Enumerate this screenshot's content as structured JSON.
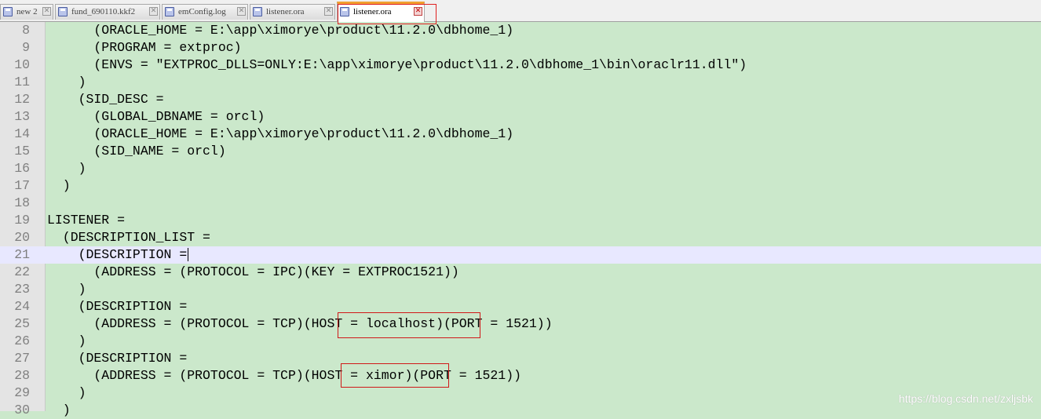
{
  "tabs": [
    {
      "label": "new 2",
      "active": false
    },
    {
      "label": "fund_690110.kkf2",
      "active": false
    },
    {
      "label": "emConfig.log",
      "active": false
    },
    {
      "label": "listener.ora",
      "active": false
    },
    {
      "label": "listener.ora",
      "active": true
    }
  ],
  "editor": {
    "current_line": 21,
    "lines": [
      {
        "num": "8",
        "text": "      (ORACLE_HOME = E:\\app\\ximorye\\product\\11.2.0\\dbhome_1)"
      },
      {
        "num": "9",
        "text": "      (PROGRAM = extproc)"
      },
      {
        "num": "10",
        "text": "      (ENVS = \"EXTPROC_DLLS=ONLY:E:\\app\\ximorye\\product\\11.2.0\\dbhome_1\\bin\\oraclr11.dll\")"
      },
      {
        "num": "11",
        "text": "    )"
      },
      {
        "num": "12",
        "text": "    (SID_DESC ="
      },
      {
        "num": "13",
        "text": "      (GLOBAL_DBNAME = orcl)"
      },
      {
        "num": "14",
        "text": "      (ORACLE_HOME = E:\\app\\ximorye\\product\\11.2.0\\dbhome_1)"
      },
      {
        "num": "15",
        "text": "      (SID_NAME = orcl)"
      },
      {
        "num": "16",
        "text": "    )"
      },
      {
        "num": "17",
        "text": "  )"
      },
      {
        "num": "18",
        "text": ""
      },
      {
        "num": "19",
        "text": "LISTENER ="
      },
      {
        "num": "20",
        "text": "  (DESCRIPTION_LIST ="
      },
      {
        "num": "21",
        "text": "    (DESCRIPTION ="
      },
      {
        "num": "22",
        "text": "      (ADDRESS = (PROTOCOL = IPC)(KEY = EXTPROC1521))"
      },
      {
        "num": "23",
        "text": "    )"
      },
      {
        "num": "24",
        "text": "    (DESCRIPTION ="
      },
      {
        "num": "25",
        "text": "      (ADDRESS = (PROTOCOL = TCP)(HOST = localhost)(PORT = 1521))"
      },
      {
        "num": "26",
        "text": "    )"
      },
      {
        "num": "27",
        "text": "    (DESCRIPTION ="
      },
      {
        "num": "28",
        "text": "      (ADDRESS = (PROTOCOL = TCP)(HOST = ximor)(PORT = 1521))"
      },
      {
        "num": "29",
        "text": "    )"
      },
      {
        "num": "30",
        "text": "  )"
      }
    ]
  },
  "watermark": "https://blog.csdn.net/zxljsbk",
  "colors": {
    "editor_bg": "#cbe8cb",
    "current_line_bg": "#e8e8ff",
    "annotation_red": "#d01818",
    "active_tab_accent": "#f0a030"
  }
}
